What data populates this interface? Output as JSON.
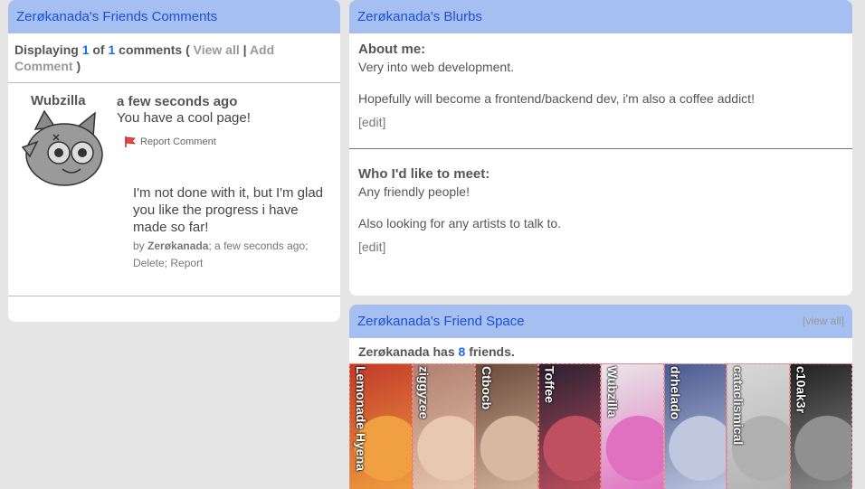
{
  "comments": {
    "title": "Zerøkanada's Friends Comments",
    "displaying_prefix": "Displaying",
    "shown": "1",
    "of_label": "of",
    "total": "1",
    "comments_label": "comments (",
    "view_all": "View all",
    "pipe": "|",
    "add_comment": "Add Comment",
    "close_paren": ")",
    "items": [
      {
        "user": "Wubzilla",
        "time": "a few seconds ago",
        "text": "You have a cool page!",
        "report_label": "Report Comment",
        "reply": {
          "text": "I'm not done with it, but I'm glad you like the progress i have made so far!",
          "by_prefix": "by",
          "author": "Zerøkanada",
          "time_suffix": "; a few seconds ago;",
          "delete_label": "Delete",
          "semicolon": ";",
          "report_label": "Report"
        }
      }
    ]
  },
  "blurbs": {
    "title": "Zerøkanada's Blurbs",
    "about_heading": "About me:",
    "about_line1": "Very into web development.",
    "about_line2": "Hopefully will become a frontend/backend dev, i'm also a coffee addict!",
    "meet_heading": "Who I'd like to meet:",
    "meet_line1": "Any friendly people!",
    "meet_line2": "Also looking for any artists to talk to.",
    "edit_label": "[edit]"
  },
  "friends": {
    "title": "Zerøkanada's Friend Space",
    "view_all": "[view all]",
    "owner": "Zerøkanada",
    "has_label": "has",
    "count": "8",
    "friends_label": "friends.",
    "list": [
      {
        "name": "Lemonade Hyena",
        "colors": [
          "#c23a2a",
          "#f0a040"
        ]
      },
      {
        "name": "ziggyzee",
        "colors": [
          "#b08070",
          "#e8c8b0"
        ]
      },
      {
        "name": "Ctbocb",
        "colors": [
          "#6a4a3a",
          "#d8b8a0"
        ]
      },
      {
        "name": "Toffee",
        "colors": [
          "#2a2030",
          "#c05060"
        ]
      },
      {
        "name": "Wubzilla",
        "colors": [
          "#e8e8e8",
          "#e070c0"
        ]
      },
      {
        "name": "drhelado",
        "colors": [
          "#4a5a90",
          "#c0c8e0"
        ]
      },
      {
        "name": "cataclismical",
        "colors": [
          "#d8d8d8",
          "#b0b0b0"
        ]
      },
      {
        "name": "c10ak3r",
        "colors": [
          "#202020",
          "#909090"
        ]
      }
    ]
  }
}
